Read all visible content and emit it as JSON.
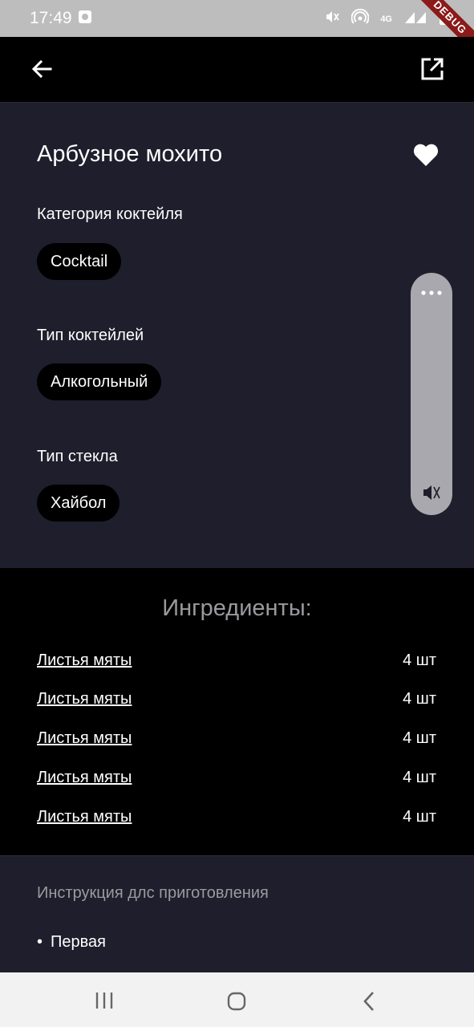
{
  "status_bar": {
    "time": "17:49",
    "icons": [
      "photo-icon",
      "mute-icon",
      "hotspot-icon",
      "signal-icon",
      "battery-icon"
    ],
    "network_label": "4G",
    "debug_banner": "DEBUG"
  },
  "app_bar": {
    "back_icon": "arrow-back-icon",
    "share_icon": "open-external-icon"
  },
  "drink": {
    "title": "Арбузное мохито",
    "favorite_icon": "heart-icon",
    "category_label": "Категория коктейля",
    "category_value": "Cocktail",
    "type_label": "Тип коктейлей",
    "type_value": "Алкогольный",
    "glass_label": "Тип стекла",
    "glass_value": "Хайбол"
  },
  "ingredients": {
    "title": "Ингредиенты:",
    "items": [
      {
        "name": "Листья мяты",
        "quantity": "4 шт"
      },
      {
        "name": "Листья мяты",
        "quantity": "4 шт"
      },
      {
        "name": "Листья мяты",
        "quantity": "4 шт"
      },
      {
        "name": "Листья мяты",
        "quantity": "4 шт"
      },
      {
        "name": "Листья мяты",
        "quantity": "4 шт"
      }
    ]
  },
  "instructions": {
    "title": "Инструкция длс приготовления",
    "steps": [
      "Первая"
    ]
  },
  "colors": {
    "panel_background": "#1e1e2c",
    "chip_background": "#000000",
    "muted_text": "#9a9a9e"
  }
}
